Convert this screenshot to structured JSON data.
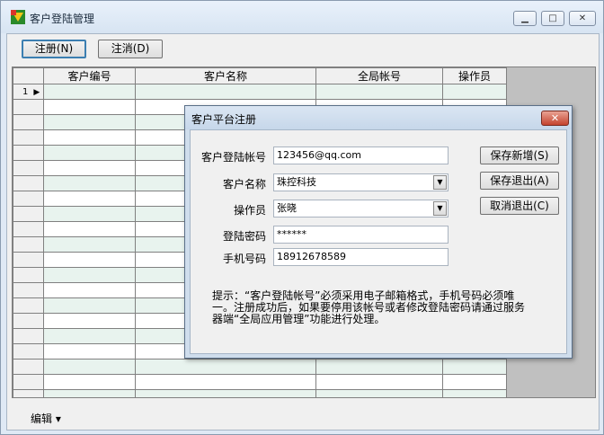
{
  "window": {
    "title": "客户登陆管理",
    "min_glyph": "▁",
    "max_glyph": "□",
    "close_glyph": "✕"
  },
  "toolbar": {
    "register_label": "注册(N)",
    "cancel_label": "注消(D)"
  },
  "grid": {
    "columns": [
      "客户编号",
      "客户名称",
      "全局帐号",
      "操作员"
    ],
    "first_row_number": "1",
    "first_row_indicator": "▶"
  },
  "footer": {
    "edit_menu_label": "编辑 ▾"
  },
  "dialog": {
    "title": "客户平台注册",
    "close_glyph": "✕",
    "labels": {
      "account": "客户登陆帐号",
      "name": "客户名称",
      "operator": "操作员",
      "password": "登陆密码",
      "phone": "手机号码"
    },
    "values": {
      "account": "123456@qq.com",
      "name": "珠控科技",
      "operator": "张晓",
      "password": "******",
      "phone": "18912678589"
    },
    "combo_arrow": "▼",
    "buttons": {
      "save_new": "保存新增(S)",
      "save_exit": "保存退出(A)",
      "cancel_exit": "取消退出(C)"
    },
    "hint": "提示：“客户登陆帐号”必须采用电子邮箱格式，手机号码必须唯一。注册成功后，如果要停用该帐号或者修改登陆密码请通过服务器端“全局应用管理”功能进行处理。"
  }
}
